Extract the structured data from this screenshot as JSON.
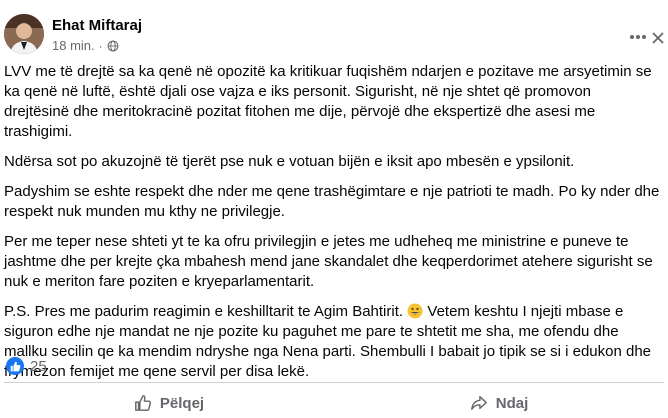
{
  "post": {
    "author": "Ehat Miftaraj",
    "time": "18 min.",
    "dot": "·",
    "paragraphs": [
      "LVV me të drejtë sa ka qenë në opozitë ka kritikuar fuqishëm ndarjen e pozitave me arsyetimin se ka qenë në luftë, është djali ose vajza e iks personit.  Sigurisht, në nje shtet që promovon drejtësinë dhe meritokracinë pozitat fitohen me dije, përvojë dhe ekspertizë dhe asesi me trashigimi.",
      "Ndërsa sot po akuzojnë të tjerët pse nuk e votuan bijën e iksit apo mbesën e ypsilonit.",
      "Padyshim se eshte respekt dhe nder me qene trashëgimtare e nje patrioti te madh.  Po ky nder dhe respekt nuk munden mu kthy ne privilegje.",
      "Per me teper nese shteti yt te ka ofru privilegjin e jetes me udheheq me ministrine e puneve te jashtme dhe per krejte çka mbahesh mend jane skandalet dhe keqperdorimet atehere sigurisht se nuk e meriton fare poziten e kryeparlamentarit."
    ],
    "ps_before_emoji": "P.S. Pres me padurim reagimin e keshilltarit te Agim Bahtirit. ",
    "ps_after_emoji": " Vetem keshtu I njejti mbase e siguron edhe nje mandat ne nje pozite ku paguhet me pare te shtetit me sha, me ofendu dhe mallku secilin qe ka mendim ndryshe nga Nena parti. Shembulli I babait jo tipik se si i edukon dhe frymezon femijet me qene servil per disa lekë.",
    "reaction_count": "25",
    "like_label": "Pëlqej",
    "share_label": "Ndaj"
  },
  "colors": {
    "text": "#050505",
    "secondary": "#65676b",
    "accent": "#1877f2",
    "divider": "#ced0d4"
  },
  "icons": {
    "avatar": "profile-photo",
    "globe": "public-globe-icon",
    "more": "more-options-icon",
    "close": "close-icon",
    "like_badge": "like-reaction-icon",
    "like": "thumbs-up-icon",
    "share": "share-arrow-icon",
    "emoji": "grinning-emoji-icon"
  }
}
